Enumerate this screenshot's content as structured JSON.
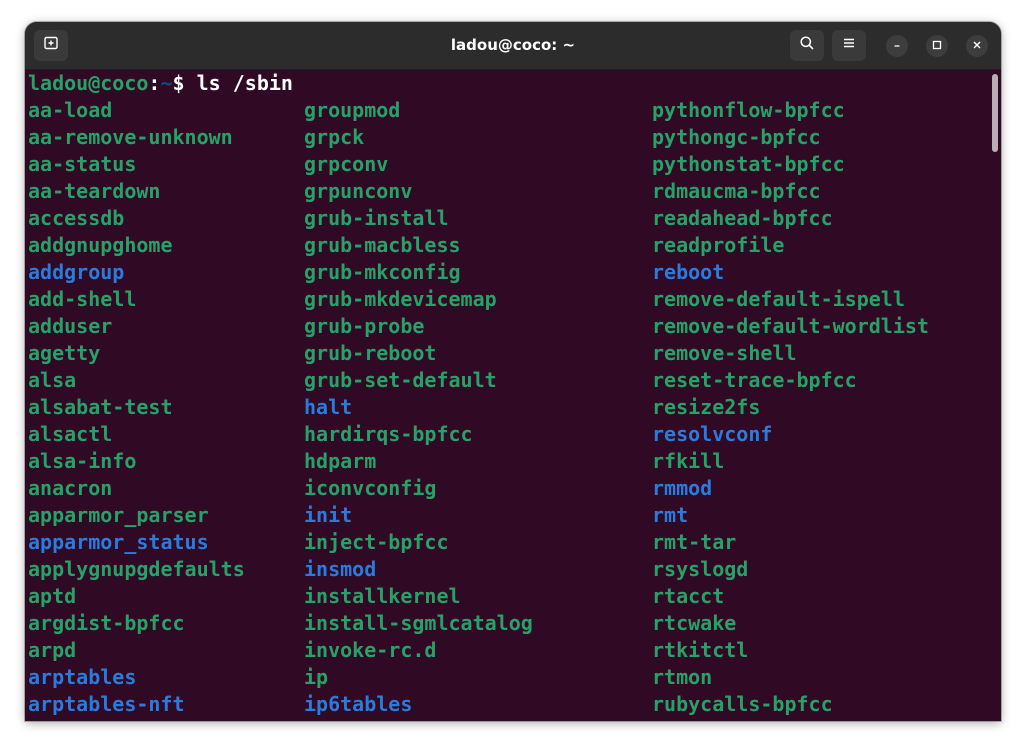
{
  "window": {
    "title": "ladou@coco: ~"
  },
  "prompt": {
    "user_host": "ladou@coco",
    "colon": ":",
    "path": "~",
    "symbol": "$ ",
    "command": "ls /sbin"
  },
  "colors": {
    "background": "#300a24",
    "executable": "#26a269",
    "symlink": "#2a7bde",
    "titlebar": "#2c2c2c"
  },
  "icons": {
    "new_tab": "new-tab-icon",
    "search": "search-icon",
    "menu": "hamburger-menu-icon",
    "minimize": "minimize-icon",
    "maximize": "maximize-icon",
    "close": "close-icon"
  },
  "listing": {
    "columns": [
      [
        {
          "name": "aa-load",
          "type": "exe"
        },
        {
          "name": "aa-remove-unknown",
          "type": "exe"
        },
        {
          "name": "aa-status",
          "type": "exe"
        },
        {
          "name": "aa-teardown",
          "type": "exe"
        },
        {
          "name": "accessdb",
          "type": "exe"
        },
        {
          "name": "addgnupghome",
          "type": "exe"
        },
        {
          "name": "addgroup",
          "type": "link"
        },
        {
          "name": "add-shell",
          "type": "exe"
        },
        {
          "name": "adduser",
          "type": "exe"
        },
        {
          "name": "agetty",
          "type": "exe"
        },
        {
          "name": "alsa",
          "type": "exe"
        },
        {
          "name": "alsabat-test",
          "type": "exe"
        },
        {
          "name": "alsactl",
          "type": "exe"
        },
        {
          "name": "alsa-info",
          "type": "exe"
        },
        {
          "name": "anacron",
          "type": "exe"
        },
        {
          "name": "apparmor_parser",
          "type": "exe"
        },
        {
          "name": "apparmor_status",
          "type": "link"
        },
        {
          "name": "applygnupgdefaults",
          "type": "exe"
        },
        {
          "name": "aptd",
          "type": "exe"
        },
        {
          "name": "argdist-bpfcc",
          "type": "exe"
        },
        {
          "name": "arpd",
          "type": "exe"
        },
        {
          "name": "arptables",
          "type": "link"
        },
        {
          "name": "arptables-nft",
          "type": "link"
        }
      ],
      [
        {
          "name": "groupmod",
          "type": "exe"
        },
        {
          "name": "grpck",
          "type": "exe"
        },
        {
          "name": "grpconv",
          "type": "exe"
        },
        {
          "name": "grpunconv",
          "type": "exe"
        },
        {
          "name": "grub-install",
          "type": "exe"
        },
        {
          "name": "grub-macbless",
          "type": "exe"
        },
        {
          "name": "grub-mkconfig",
          "type": "exe"
        },
        {
          "name": "grub-mkdevicemap",
          "type": "exe"
        },
        {
          "name": "grub-probe",
          "type": "exe"
        },
        {
          "name": "grub-reboot",
          "type": "exe"
        },
        {
          "name": "grub-set-default",
          "type": "exe"
        },
        {
          "name": "halt",
          "type": "link"
        },
        {
          "name": "hardirqs-bpfcc",
          "type": "exe"
        },
        {
          "name": "hdparm",
          "type": "exe"
        },
        {
          "name": "iconvconfig",
          "type": "exe"
        },
        {
          "name": "init",
          "type": "link"
        },
        {
          "name": "inject-bpfcc",
          "type": "exe"
        },
        {
          "name": "insmod",
          "type": "link"
        },
        {
          "name": "installkernel",
          "type": "exe"
        },
        {
          "name": "install-sgmlcatalog",
          "type": "exe"
        },
        {
          "name": "invoke-rc.d",
          "type": "exe"
        },
        {
          "name": "ip",
          "type": "exe"
        },
        {
          "name": "ip6tables",
          "type": "link"
        }
      ],
      [
        {
          "name": "pythonflow-bpfcc",
          "type": "exe"
        },
        {
          "name": "pythongc-bpfcc",
          "type": "exe"
        },
        {
          "name": "pythonstat-bpfcc",
          "type": "exe"
        },
        {
          "name": "rdmaucma-bpfcc",
          "type": "exe"
        },
        {
          "name": "readahead-bpfcc",
          "type": "exe"
        },
        {
          "name": "readprofile",
          "type": "exe"
        },
        {
          "name": "reboot",
          "type": "link"
        },
        {
          "name": "remove-default-ispell",
          "type": "exe"
        },
        {
          "name": "remove-default-wordlist",
          "type": "exe"
        },
        {
          "name": "remove-shell",
          "type": "exe"
        },
        {
          "name": "reset-trace-bpfcc",
          "type": "exe"
        },
        {
          "name": "resize2fs",
          "type": "exe"
        },
        {
          "name": "resolvconf",
          "type": "link"
        },
        {
          "name": "rfkill",
          "type": "exe"
        },
        {
          "name": "rmmod",
          "type": "link"
        },
        {
          "name": "rmt",
          "type": "link"
        },
        {
          "name": "rmt-tar",
          "type": "exe"
        },
        {
          "name": "rsyslogd",
          "type": "exe"
        },
        {
          "name": "rtacct",
          "type": "exe"
        },
        {
          "name": "rtcwake",
          "type": "exe"
        },
        {
          "name": "rtkitctl",
          "type": "exe"
        },
        {
          "name": "rtmon",
          "type": "exe"
        },
        {
          "name": "rubycalls-bpfcc",
          "type": "exe"
        }
      ]
    ]
  }
}
